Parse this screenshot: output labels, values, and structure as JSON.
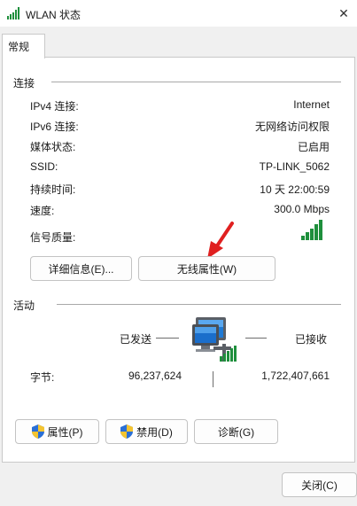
{
  "window": {
    "title": "WLAN 状态",
    "close_glyph": "✕"
  },
  "tabs": [
    {
      "label": "常规"
    }
  ],
  "connection": {
    "heading": "连接",
    "rows": [
      {
        "label": "IPv4 连接:",
        "value": "Internet"
      },
      {
        "label": "IPv6 连接:",
        "value": "无网络访问权限"
      },
      {
        "label": "媒体状态:",
        "value": "已启用"
      },
      {
        "label": "SSID:",
        "value": "TP-LINK_5062"
      },
      {
        "label": "持续时间:",
        "value": "10 天 22:00:59"
      },
      {
        "label": "速度:",
        "value": "300.0 Mbps"
      }
    ],
    "signal_label": "信号质量:",
    "signal_level": "5/5",
    "details_button": "详细信息(E)...",
    "wireless_props_button": "无线属性(W)"
  },
  "activity": {
    "heading": "活动",
    "sent_label": "已发送",
    "received_label": "已接收",
    "bytes_label": "字节:",
    "bytes_sent": "96,237,624",
    "bytes_received": "1,722,407,661"
  },
  "actions": {
    "properties_button": "属性(P)",
    "disable_button": "禁用(D)",
    "diagnose_button": "诊断(G)"
  },
  "footer": {
    "close_button": "关闭(C)"
  },
  "colors": {
    "signal": "#1e8f3c",
    "annotation_arrow": "#e02020",
    "shield_blue": "#2a6fd6",
    "shield_yellow": "#f4c430"
  }
}
